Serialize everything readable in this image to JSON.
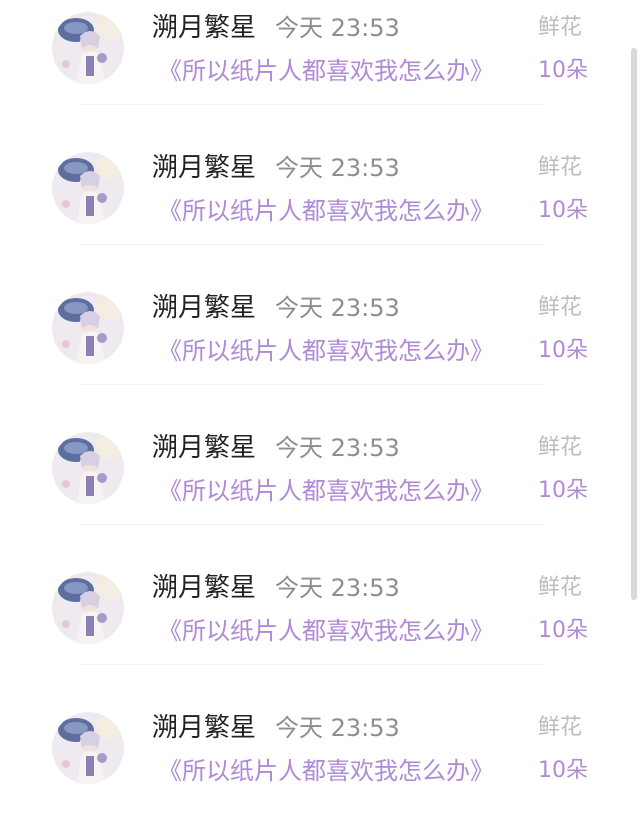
{
  "items": [
    {
      "name": "溯月繁星",
      "time": "今天 23:53",
      "book": "《所以纸片人都喜欢我怎么办》",
      "gift": "鲜花",
      "count": "10朵"
    },
    {
      "name": "溯月繁星",
      "time": "今天 23:53",
      "book": "《所以纸片人都喜欢我怎么办》",
      "gift": "鲜花",
      "count": "10朵"
    },
    {
      "name": "溯月繁星",
      "time": "今天 23:53",
      "book": "《所以纸片人都喜欢我怎么办》",
      "gift": "鲜花",
      "count": "10朵"
    },
    {
      "name": "溯月繁星",
      "time": "今天 23:53",
      "book": "《所以纸片人都喜欢我怎么办》",
      "gift": "鲜花",
      "count": "10朵"
    },
    {
      "name": "溯月繁星",
      "time": "今天 23:53",
      "book": "《所以纸片人都喜欢我怎么办》",
      "gift": "鲜花",
      "count": "10朵"
    },
    {
      "name": "溯月繁星",
      "time": "今天 23:53",
      "book": "《所以纸片人都喜欢我怎么办》",
      "gift": "鲜花",
      "count": "10朵"
    }
  ],
  "colors": {
    "accent": "#b08ad6",
    "name_text": "#222222",
    "secondary_text": "#8e8e8e",
    "muted_text": "#bdbdbd",
    "divider": "#f0f0f2"
  },
  "icons": {
    "avatar": "user-avatar-illustration"
  }
}
